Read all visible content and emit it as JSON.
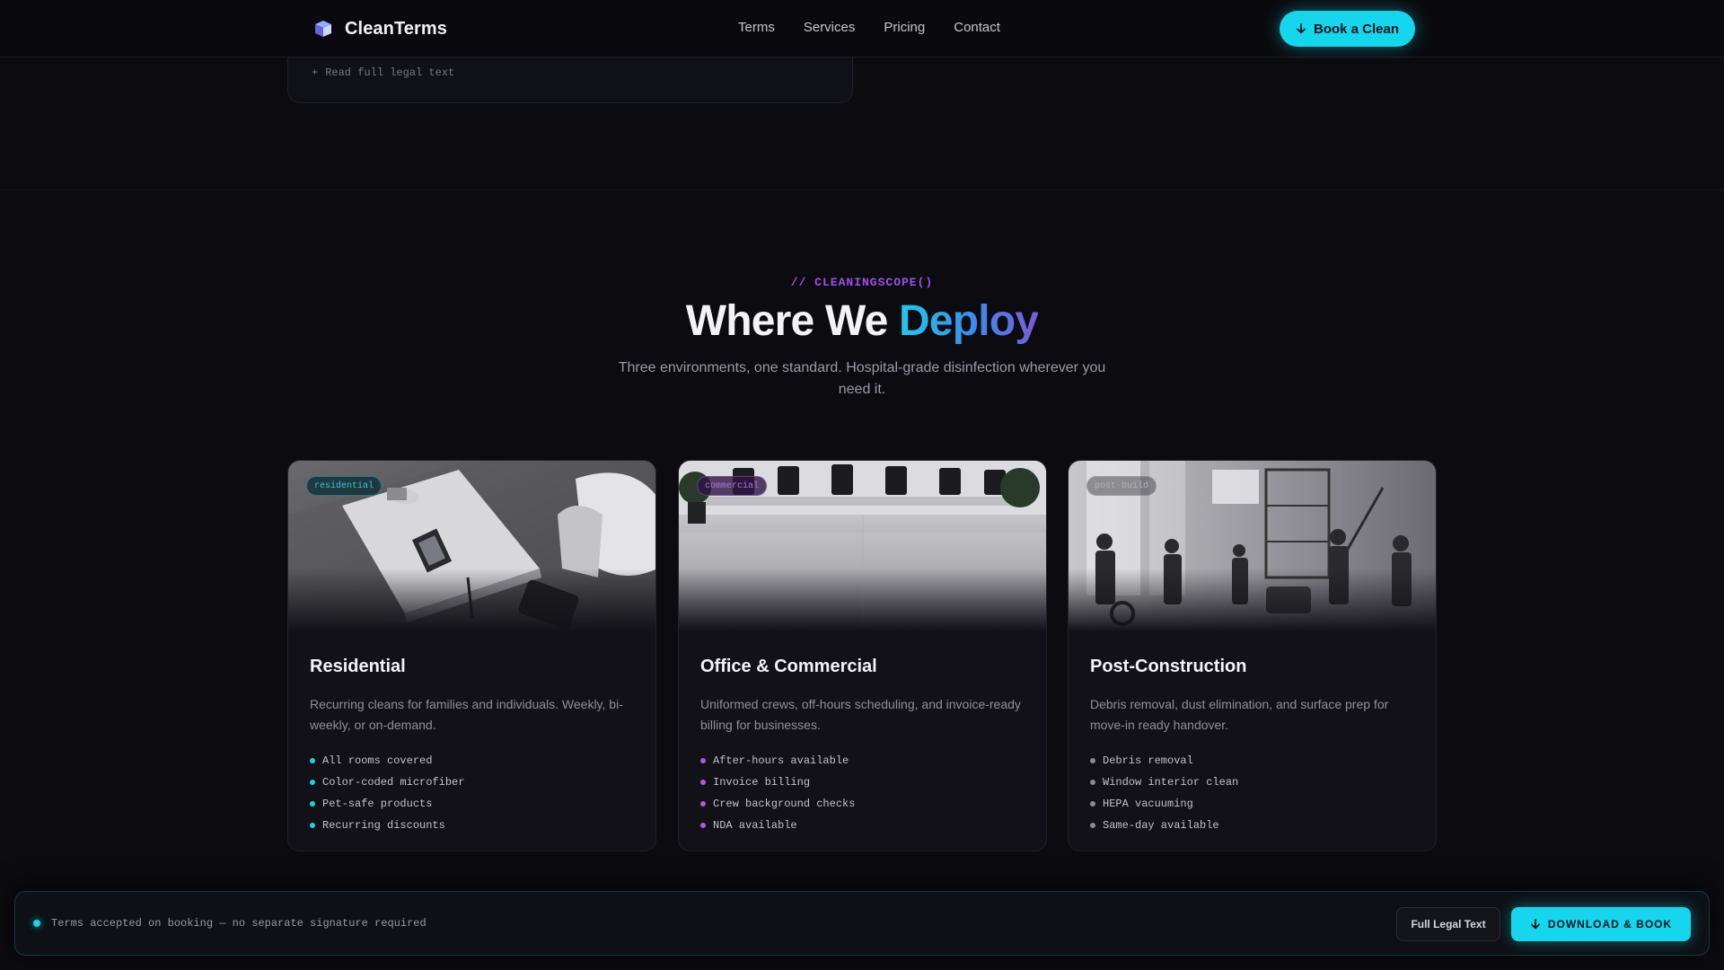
{
  "nav": {
    "brand": "CleanTerms",
    "links": [
      "Terms",
      "Services",
      "Pricing",
      "Contact"
    ],
    "cta_label": "Book a Clean"
  },
  "legal_card": {
    "link_label": "Read full legal text",
    "link_prefix": "+"
  },
  "section": {
    "eyebrow": "// CLEANINGSCOPE()",
    "title_main": "Where We ",
    "title_accent": "Deploy",
    "subtitle": "Three environments, one standard. Hospital-grade disinfection wherever you need it."
  },
  "cards": [
    {
      "tag": "residential",
      "title": "Residential",
      "description": "Recurring cleans for families and individuals. Weekly, bi-weekly, or on-demand.",
      "features": [
        "All rooms covered",
        "Color-coded microfiber",
        "Pet-safe products",
        "Recurring discounts"
      ],
      "accent": "#19d3e8"
    },
    {
      "tag": "commercial",
      "title": "Office & Commercial",
      "description": "Uniformed crews, off-hours scheduling, and invoice-ready billing for businesses.",
      "features": [
        "After-hours available",
        "Invoice billing",
        "Crew background checks",
        "NDA available"
      ],
      "accent": "#a85ae8"
    },
    {
      "tag": "post-build",
      "title": "Post-Construction",
      "description": "Debris removal, dust elimination, and surface prep for move-in ready handover.",
      "features": [
        "Debris removal",
        "Window interior clean",
        "HEPA vacuuming",
        "Same-day available"
      ],
      "accent": "#8a8a94"
    }
  ],
  "bottom_bar": {
    "note": "Terms accepted on booking — no separate signature required",
    "secondary_label": "Full Legal Text",
    "primary_label": "DOWNLOAD & BOOK"
  },
  "colors": {
    "background": "#0b0b10",
    "accent_cyan": "#16d6ee",
    "accent_purple": "#a04ee8"
  },
  "icons": {
    "brand": "cube-logo-icon",
    "cta": "arrow-down-icon"
  }
}
